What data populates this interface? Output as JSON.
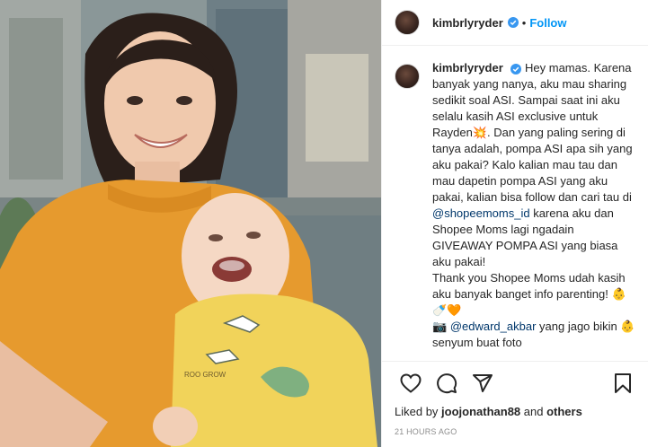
{
  "post": {
    "username": "kimbrlyryder",
    "separator": "•",
    "follow_label": "Follow",
    "caption": {
      "username": "kimbrlyryder",
      "line1": "Hey mamas. Karena banyak yang nanya, aku mau sharing sedikit soal ASI. Sampai saat ini aku selalu kasih ASI exclusive untuk Rayden💥. Dan yang paling sering di tanya adalah, pompa ASI apa sih yang aku pakai? Kalo kalian mau tau dan mau dapetin pompa ASI yang aku pakai, kalian bisa follow dan cari tau di ",
      "mention1": "@shopeemoms_id",
      "line1_end": " karena aku dan Shopee Moms lagi ngadain GIVEAWAY POMPA ASI yang biasa aku pakai!",
      "line2": "Thank you Shopee Moms udah kasih aku banyak banget info parenting! 👶🍼🧡",
      "line3_prefix": "📷 ",
      "mention2": "@edward_akbar",
      "line3_end": " yang jago bikin 👶 senyum buat foto"
    },
    "comment_time": "21h",
    "likes_prefix": "Liked by ",
    "likes_user": "joojonathan88",
    "likes_mid": " and ",
    "likes_others": "others",
    "posted_ago": "21 HOURS AGO"
  },
  "icons": {
    "verified": "verified-badge-icon",
    "like": "heart-icon",
    "comment": "comment-icon",
    "share": "share-icon",
    "save": "bookmark-icon"
  },
  "colors": {
    "accent": "#0095f6",
    "verified": "#3897f0",
    "mention": "#00376b",
    "muted": "#8e8e8e"
  }
}
